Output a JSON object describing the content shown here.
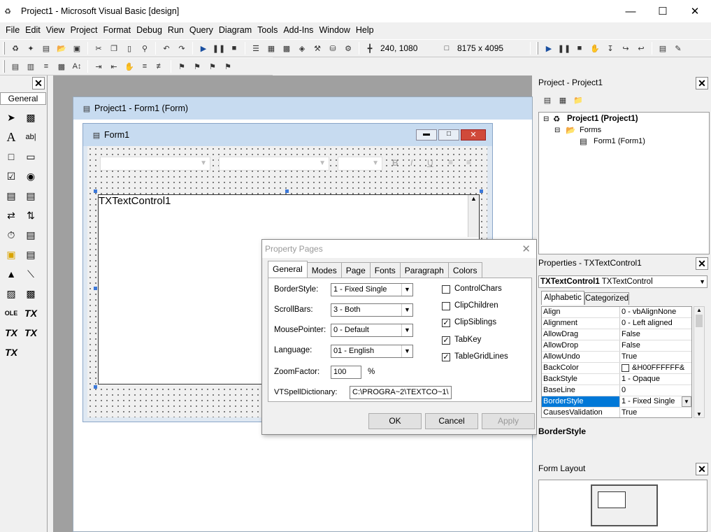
{
  "window": {
    "title": "Project1 - Microsoft Visual Basic [design]",
    "min": "—",
    "max": "☐",
    "close": "✕"
  },
  "menu": [
    "File",
    "Edit",
    "View",
    "Project",
    "Format",
    "Debug",
    "Run",
    "Query",
    "Diagram",
    "Tools",
    "Add-Ins",
    "Window",
    "Help"
  ],
  "toolbar": {
    "position": "240, 1080",
    "size": "8175 x 4095"
  },
  "toolbox": {
    "tab": "General"
  },
  "formwin": {
    "title": "Project1 - Form1 (Form)"
  },
  "form1": {
    "title": "Form1",
    "control_text": "TXTextControl1"
  },
  "dialog": {
    "title": "Property Pages",
    "tabs": [
      "General",
      "Modes",
      "Page",
      "Fonts",
      "Paragraph",
      "Colors"
    ],
    "fields": {
      "border_label": "BorderStyle:",
      "border_value": "1 - Fixed Single",
      "scroll_label": "ScrollBars:",
      "scroll_value": "3 - Both",
      "mouse_label": "MousePointer:",
      "mouse_value": "0 - Default",
      "lang_label": "Language:",
      "lang_value": "01 - English",
      "zoom_label": "ZoomFactor:",
      "zoom_value": "100",
      "zoom_unit": "%",
      "spell_label": "VTSpellDictionary:",
      "spell_value": "C:\\PROGRA~2\\TEXTCO~1\\"
    },
    "checks": [
      {
        "label": "ControlChars",
        "checked": false
      },
      {
        "label": "ClipChildren",
        "checked": false
      },
      {
        "label": "ClipSiblings",
        "checked": true
      },
      {
        "label": "TabKey",
        "checked": true
      },
      {
        "label": "TableGridLines",
        "checked": true
      }
    ],
    "ok": "OK",
    "cancel": "Cancel",
    "apply": "Apply"
  },
  "project": {
    "title": "Project - Project1",
    "root": "Project1 (Project1)",
    "folder": "Forms",
    "item": "Form1 (Form1)"
  },
  "properties": {
    "title": "Properties - TXTextControl1",
    "object": "TXTextControl1",
    "object_type": "TXTextControl",
    "tab_alpha": "Alphabetic",
    "tab_cat": "Categorized",
    "rows": [
      {
        "n": "Align",
        "v": "0 - vbAlignNone"
      },
      {
        "n": "Alignment",
        "v": "0 - Left aligned"
      },
      {
        "n": "AllowDrag",
        "v": "False"
      },
      {
        "n": "AllowDrop",
        "v": "False"
      },
      {
        "n": "AllowUndo",
        "v": "True"
      },
      {
        "n": "BackColor",
        "v": "&H00FFFFFF&"
      },
      {
        "n": "BackStyle",
        "v": "1 - Opaque"
      },
      {
        "n": "BaseLine",
        "v": "0"
      },
      {
        "n": "BorderStyle",
        "v": "1 - Fixed Single"
      },
      {
        "n": "CausesValidation",
        "v": "True"
      }
    ],
    "desc": "BorderStyle"
  },
  "layout": {
    "title": "Form Layout"
  }
}
